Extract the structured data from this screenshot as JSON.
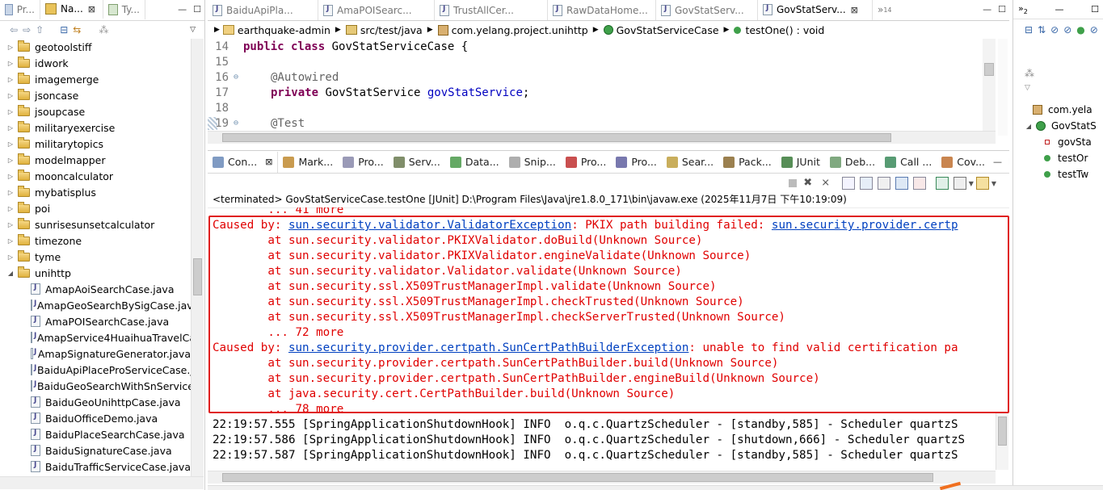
{
  "left_panel": {
    "tabs": [
      {
        "label": "Pr...",
        "close": ""
      },
      {
        "label": "Na...",
        "close": "⊠"
      },
      {
        "label": "Ty...",
        "close": ""
      }
    ],
    "tree": [
      {
        "label": "geotoolstiff",
        "type": "folder",
        "expanded": false
      },
      {
        "label": "idwork",
        "type": "folder",
        "expanded": false
      },
      {
        "label": "imagemerge",
        "type": "folder",
        "expanded": false
      },
      {
        "label": "jsoncase",
        "type": "folder",
        "expanded": false
      },
      {
        "label": "jsoupcase",
        "type": "folder",
        "expanded": false
      },
      {
        "label": "militaryexercise",
        "type": "folder",
        "expanded": false
      },
      {
        "label": "militarytopics",
        "type": "folder",
        "expanded": false
      },
      {
        "label": "modelmapper",
        "type": "folder",
        "expanded": false
      },
      {
        "label": "mooncalculator",
        "type": "folder",
        "expanded": false
      },
      {
        "label": "mybatisplus",
        "type": "folder",
        "expanded": false
      },
      {
        "label": "poi",
        "type": "folder",
        "expanded": false
      },
      {
        "label": "sunrisesunsetcalculator",
        "type": "folder",
        "expanded": false
      },
      {
        "label": "timezone",
        "type": "folder",
        "expanded": false
      },
      {
        "label": "tyme",
        "type": "folder",
        "expanded": false
      },
      {
        "label": "unihttp",
        "type": "folder",
        "expanded": true
      },
      {
        "label": "AmapAoiSearchCase.java",
        "type": "file"
      },
      {
        "label": "AmapGeoSearchBySigCase.java",
        "type": "file"
      },
      {
        "label": "AmaPOISearchCase.java",
        "type": "file"
      },
      {
        "label": "AmapService4HuaihuaTravelCa",
        "type": "file"
      },
      {
        "label": "AmapSignatureGenerator.java",
        "type": "file"
      },
      {
        "label": "BaiduApiPlaceProServiceCase.j",
        "type": "file"
      },
      {
        "label": "BaiduGeoSearchWithSnService",
        "type": "file"
      },
      {
        "label": "BaiduGeoUnihttpCase.java",
        "type": "file"
      },
      {
        "label": "BaiduOfficeDemo.java",
        "type": "file"
      },
      {
        "label": "BaiduPlaceSearchCase.java",
        "type": "file"
      },
      {
        "label": "BaiduSignatureCase.java",
        "type": "file"
      },
      {
        "label": "BaiduTrafficServiceCase.java",
        "type": "file"
      }
    ]
  },
  "editor": {
    "tabs": [
      {
        "label": "BaiduApiPla...",
        "active": false
      },
      {
        "label": "AmaPOISearc...",
        "active": false
      },
      {
        "label": "TrustAllCer...",
        "active": false
      },
      {
        "label": "RawDataHome...",
        "active": false
      },
      {
        "label": "GovStatServ...",
        "active": false
      },
      {
        "label": "GovStatServ...",
        "active": true
      }
    ],
    "overflow_count": "14",
    "breadcrumb": [
      "earthquake-admin",
      "src/test/java",
      "com.yelang.project.unihttp",
      "GovStatServiceCase",
      "testOne() : void"
    ],
    "lines": [
      {
        "num": "14",
        "marker": "",
        "text_kw": "public class",
        "text": " GovStatServiceCase {"
      },
      {
        "num": "15",
        "marker": "",
        "text": ""
      },
      {
        "num": "16",
        "marker": "⊖",
        "annotation": "@Autowired"
      },
      {
        "num": "17",
        "marker": "",
        "text_kw": "private",
        "type_name": " GovStatService ",
        "field": "govStatService",
        "tail": ";"
      },
      {
        "num": "18",
        "marker": "",
        "text": ""
      },
      {
        "num": "19",
        "marker": "⊖",
        "annotation": "@Test"
      }
    ]
  },
  "console": {
    "tabs": [
      "Con...",
      "Mark...",
      "Pro...",
      "Serv...",
      "Data...",
      "Snip...",
      "Pro...",
      "Pro...",
      "Sear...",
      "Pack...",
      "JUnit",
      "Deb...",
      "Call ...",
      "Cov..."
    ],
    "status": "<terminated> GovStatServiceCase.testOne [JUnit] D:\\Program Files\\Java\\jre1.8.0_171\\bin\\javaw.exe (2025年11月7日 下午10:19:09)",
    "lines": [
      {
        "kind": "red",
        "text": "        ... 41 more"
      },
      {
        "kind": "caused",
        "prefix": "Caused by: ",
        "link": "sun.security.validator.ValidatorException",
        "rest": ": PKIX path building failed: ",
        "link2": "sun.security.provider.certp"
      },
      {
        "kind": "red",
        "text": "        at sun.security.validator.PKIXValidator.doBuild(Unknown Source)"
      },
      {
        "kind": "red",
        "text": "        at sun.security.validator.PKIXValidator.engineValidate(Unknown Source)"
      },
      {
        "kind": "red",
        "text": "        at sun.security.validator.Validator.validate(Unknown Source)"
      },
      {
        "kind": "red",
        "text": "        at sun.security.ssl.X509TrustManagerImpl.validate(Unknown Source)"
      },
      {
        "kind": "red",
        "text": "        at sun.security.ssl.X509TrustManagerImpl.checkTrusted(Unknown Source)"
      },
      {
        "kind": "red",
        "text": "        at sun.security.ssl.X509TrustManagerImpl.checkServerTrusted(Unknown Source)"
      },
      {
        "kind": "red",
        "text": "        ... 72 more"
      },
      {
        "kind": "caused",
        "prefix": "Caused by: ",
        "link": "sun.security.provider.certpath.SunCertPathBuilderException",
        "rest": ": unable to find valid certification pa",
        "link2": ""
      },
      {
        "kind": "red",
        "text": "        at sun.security.provider.certpath.SunCertPathBuilder.build(Unknown Source)"
      },
      {
        "kind": "red",
        "text": "        at sun.security.provider.certpath.SunCertPathBuilder.engineBuild(Unknown Source)"
      },
      {
        "kind": "red",
        "text": "        at java.security.cert.CertPathBuilder.build(Unknown Source)"
      },
      {
        "kind": "red",
        "text": "        ... 78 more"
      },
      {
        "kind": "plain",
        "text": "22:19:57.555 [SpringApplicationShutdownHook] INFO  o.q.c.QuartzScheduler - [standby,585] - Scheduler quartzS"
      },
      {
        "kind": "plain",
        "text": "22:19:57.586 [SpringApplicationShutdownHook] INFO  o.q.c.QuartzScheduler - [shutdown,666] - Scheduler quartzS"
      },
      {
        "kind": "plain",
        "text": "22:19:57.587 [SpringApplicationShutdownHook] INFO  o.q.c.QuartzScheduler - [standby,585] - Scheduler quartzS"
      }
    ]
  },
  "outline": {
    "overflow_count": "2",
    "items": [
      {
        "label": "com.yela",
        "icon": "package"
      },
      {
        "label": "GovStatS",
        "icon": "class"
      },
      {
        "label": "govSta",
        "icon": "field"
      },
      {
        "label": "testOr",
        "icon": "method"
      },
      {
        "label": "testTw",
        "icon": "method"
      }
    ]
  },
  "colors": {
    "error_text": "#e00000",
    "link": "#0040c0",
    "keyword": "#7f0055",
    "field": "#0000c0",
    "highlight_box": "#e02020"
  }
}
